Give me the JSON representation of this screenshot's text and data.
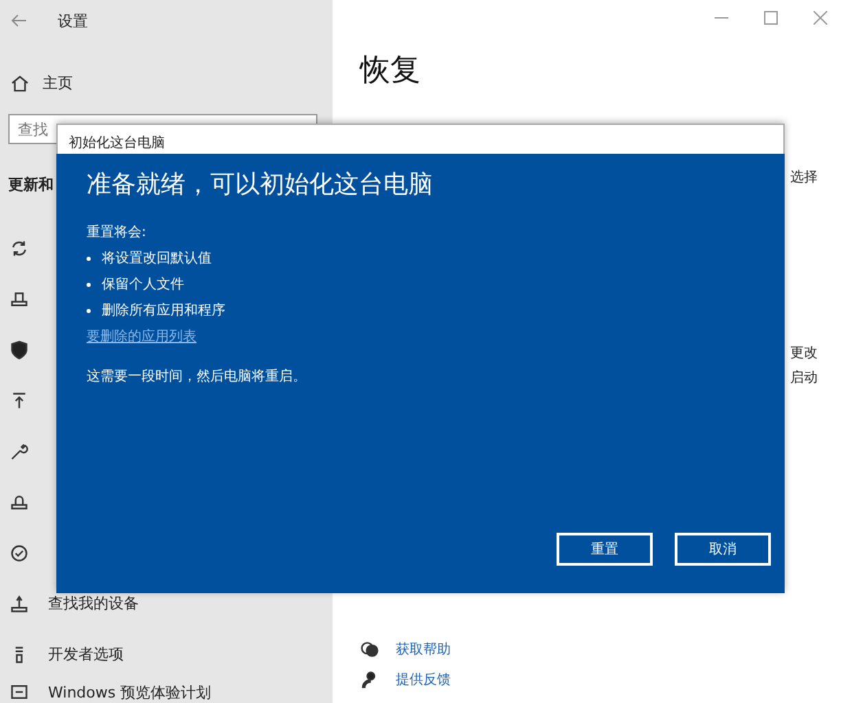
{
  "window": {
    "title": "设置"
  },
  "sidebar": {
    "home": "主页",
    "search": {
      "placeholder": "查找"
    },
    "section": "更新和",
    "items": [
      {
        "label": "查找我的设备"
      },
      {
        "label": "开发者选项"
      },
      {
        "label": "Windows 预览体验计划"
      }
    ]
  },
  "main": {
    "heading": "恢复",
    "fragments": [
      "选择",
      "更改",
      "启动"
    ],
    "links": [
      {
        "label": "获取帮助"
      },
      {
        "label": "提供反馈"
      }
    ]
  },
  "dialog": {
    "title": "初始化这台电脑",
    "heading": "准备就绪，可以初始化这台电脑",
    "intro": "重置将会:",
    "bullets": [
      "将设置改回默认值",
      "保留个人文件",
      "删除所有应用和程序"
    ],
    "link": "要删除的应用列表",
    "note": "这需要一段时间，然后电脑将重启。",
    "buttons": [
      "重置",
      "取消"
    ]
  }
}
